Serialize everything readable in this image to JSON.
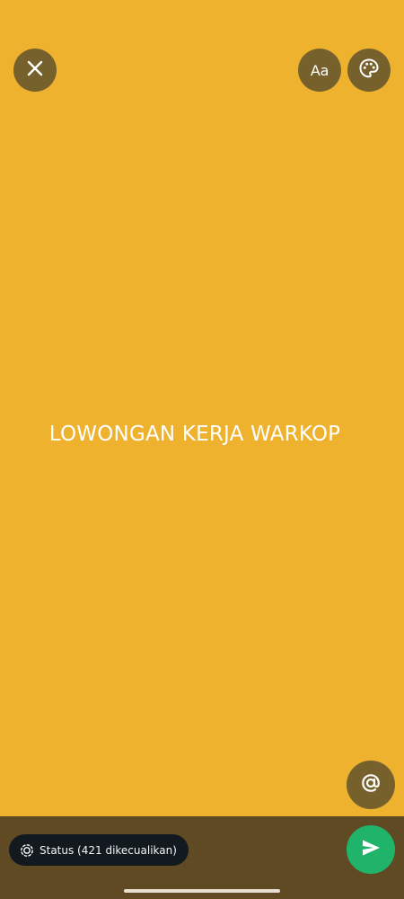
{
  "colors": {
    "background": "#EEB22F",
    "button_bg": "#76612D",
    "bottom_bar": "#5F4A24",
    "chip_bg": "#131A1F",
    "send_bg": "#20B36A",
    "text": "#FFFFFF"
  },
  "toolbar": {
    "close_icon": "close-icon",
    "font_label": "Aa",
    "palette_icon": "palette-icon"
  },
  "status": {
    "text": "LOWONGAN KERJA WARKOP"
  },
  "mention": {
    "icon": "at-sign-icon"
  },
  "audience": {
    "icon": "status-ring-icon",
    "label": "Status (421 dikecualikan)"
  },
  "send": {
    "icon": "send-icon"
  }
}
